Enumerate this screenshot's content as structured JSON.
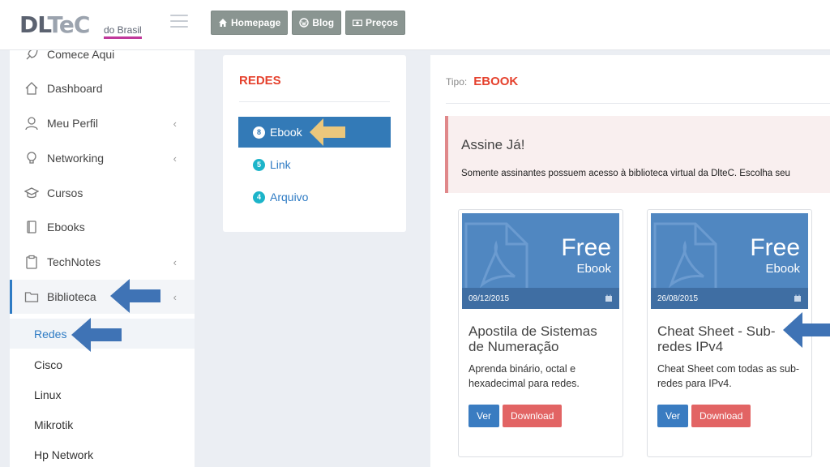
{
  "brand": {
    "logo_dl": "DL",
    "logo_tec": "TeC",
    "logo_sub": "do Brasil"
  },
  "topnav": [
    {
      "label": "Homepage",
      "icon": "home-icon"
    },
    {
      "label": "Blog",
      "icon": "wordpress-icon"
    },
    {
      "label": "Preços",
      "icon": "money-icon"
    }
  ],
  "sidebar": {
    "items": [
      {
        "label": "Comece Aqui",
        "icon": "rocket-icon"
      },
      {
        "label": "Dashboard",
        "icon": "home-icon"
      },
      {
        "label": "Meu Perfil",
        "icon": "user-icon",
        "chevron": "‹"
      },
      {
        "label": "Networking",
        "icon": "lightbulb-icon",
        "chevron": "‹"
      },
      {
        "label": "Cursos",
        "icon": "graduation-cap-icon"
      },
      {
        "label": "Ebooks",
        "icon": "book-icon"
      },
      {
        "label": "TechNotes",
        "icon": "clipboard-icon",
        "chevron": "‹"
      },
      {
        "label": "Biblioteca",
        "icon": "folder-icon",
        "chevron": "‹"
      }
    ],
    "subitems": [
      {
        "label": "Redes"
      },
      {
        "label": "Cisco"
      },
      {
        "label": "Linux"
      },
      {
        "label": "Mikrotik"
      },
      {
        "label": "Hp Network"
      }
    ]
  },
  "category": {
    "title": "REDES",
    "items": [
      {
        "count": "8",
        "label": "Ebook"
      },
      {
        "count": "5",
        "label": "Link"
      },
      {
        "count": "4",
        "label": "Arquivo"
      }
    ]
  },
  "main": {
    "tipo_label": "Tipo:",
    "tipo_value": "EBOOK",
    "alert_title": "Assine Já!",
    "alert_text": "Somente assinantes possuem acesso à biblioteca virtual da DlteC. Escolha seu",
    "cards": [
      {
        "free": "Free",
        "kind": "Ebook",
        "date": "09/12/2015",
        "title": "Apostila de Sistemas de Numeração",
        "desc": "Aprenda binário, octal e hexadecimal para redes.",
        "view": "Ver",
        "download": "Download"
      },
      {
        "free": "Free",
        "kind": "Ebook",
        "date": "26/08/2015",
        "title": "Cheat Sheet - Sub-redes IPv4",
        "desc": "Cheat Sheet com todas as sub-redes para IPv4.",
        "view": "Ver",
        "download": "Download"
      }
    ]
  },
  "colors": {
    "accent_blue": "#337ab7",
    "accent_red": "#e5412d",
    "arrow_blue": "#3f73b5",
    "arrow_yellow": "#ebc77c"
  }
}
